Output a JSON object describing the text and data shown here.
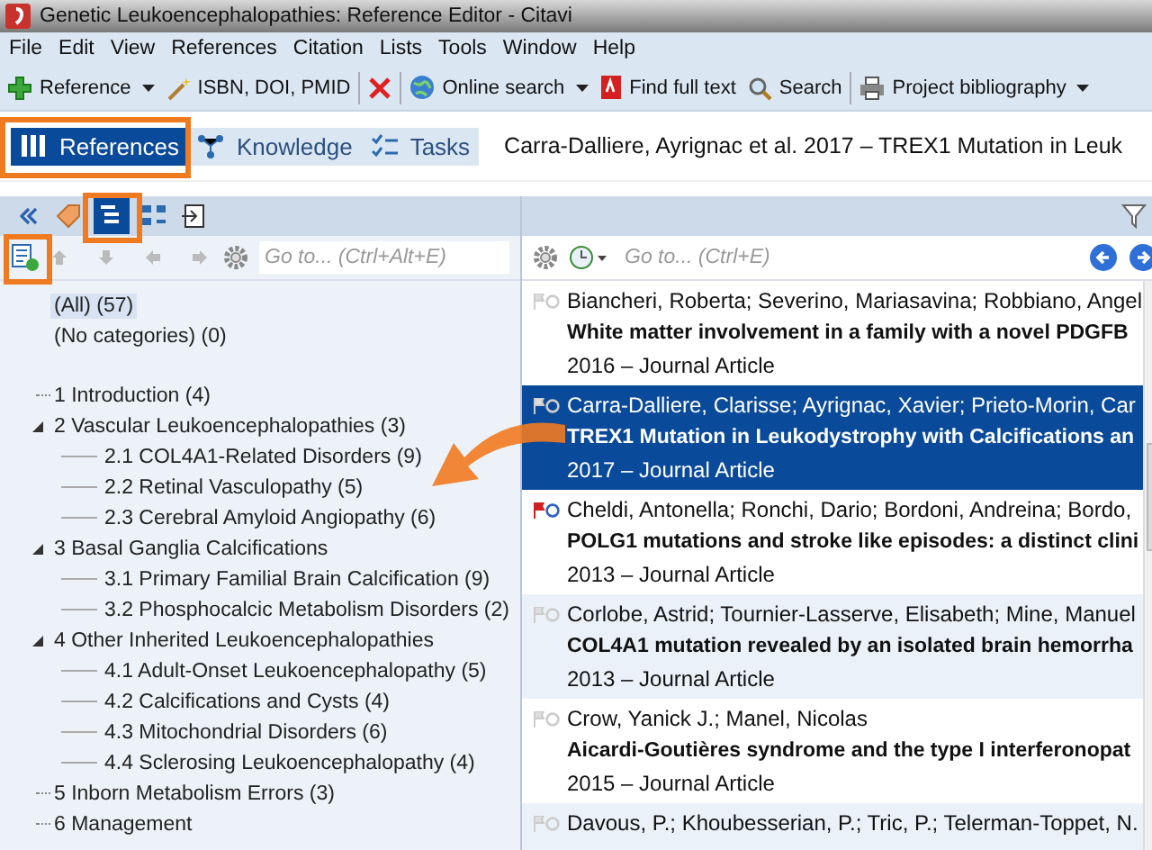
{
  "window": {
    "title": "Genetic Leukoencephalopathies: Reference Editor - Citavi"
  },
  "menu": [
    "File",
    "Edit",
    "View",
    "References",
    "Citation",
    "Lists",
    "Tools",
    "Window",
    "Help"
  ],
  "toolbar": [
    {
      "label": "Reference",
      "dropdown": true
    },
    {
      "label": "ISBN, DOI, PMID",
      "dropdown": false
    },
    {
      "label": "Online search",
      "dropdown": true
    },
    {
      "label": "Find full text",
      "dropdown": false
    },
    {
      "label": "Search",
      "dropdown": false
    },
    {
      "label": "Project bibliography",
      "dropdown": true
    }
  ],
  "tabs": [
    {
      "label": "References",
      "selected": true
    },
    {
      "label": "Knowledge",
      "selected": false
    },
    {
      "label": "Tasks",
      "selected": false
    }
  ],
  "header_title": "Carra-Dalliere, Ayrignac et al. 2017 – TREX1 Mutation in Leuk",
  "category_panel": {
    "goto_placeholder": "Go to... (Ctrl+Alt+E)",
    "special": [
      {
        "label": "(All) (57)",
        "selected": true
      },
      {
        "label": "(No categories) (0)",
        "selected": false
      }
    ],
    "tree": [
      {
        "label": "1 Introduction (4)"
      },
      {
        "label": "2 Vascular Leukoencephalopathies (3)",
        "expanded": true,
        "children": [
          {
            "label": "2.1 COL4A1-Related Disorders (9)"
          },
          {
            "label": "2.2 Retinal Vasculopathy (5)"
          },
          {
            "label": "2.3 Cerebral Amyloid Angiopathy (6)"
          }
        ]
      },
      {
        "label": "3 Basal Ganglia Calcifications",
        "expanded": true,
        "children": [
          {
            "label": "3.1 Primary Familial Brain Calcification (9)"
          },
          {
            "label": "3.2 Phosphocalcic Metabolism Disorders (2)"
          }
        ]
      },
      {
        "label": "4 Other Inherited Leukoencephalopathies",
        "expanded": true,
        "children": [
          {
            "label": "4.1 Adult-Onset Leukoencephalopathy (5)"
          },
          {
            "label": "4.2 Calcifications and Cysts (4)"
          },
          {
            "label": "4.3 Mitochondrial Disorders (6)"
          },
          {
            "label": "4.4 Sclerosing Leukoencephalopathy (4)"
          }
        ]
      },
      {
        "label": "5 Inborn Metabolism Errors (3)"
      },
      {
        "label": "6 Management"
      }
    ]
  },
  "reference_panel": {
    "goto_placeholder": "Go to... (Ctrl+E)",
    "references": [
      {
        "authors": "Biancheri, Roberta; Severino, Mariasavina; Robbiano, Angel",
        "title": "White matter involvement in a family with a novel PDGFB",
        "meta": "2016 – Journal Article",
        "flagged": false,
        "selected": false
      },
      {
        "authors": "Carra-Dalliere, Clarisse; Ayrignac, Xavier; Prieto-Morin, Car",
        "title": "TREX1 Mutation in Leukodystrophy with Calcifications an",
        "meta": "2017 – Journal Article",
        "flagged": false,
        "selected": true
      },
      {
        "authors": "Cheldi, Antonella; Ronchi, Dario; Bordoni, Andreina; Bordo,",
        "title": "POLG1 mutations and stroke like episodes: a distinct clini",
        "meta": "2013 – Journal Article",
        "flagged": true,
        "selected": false
      },
      {
        "authors": "Corlobe, Astrid; Tournier-Lasserve, Elisabeth; Mine, Manuel",
        "title": "COL4A1 mutation revealed by an isolated brain hemorrha",
        "meta": "2013 – Journal Article",
        "flagged": false,
        "selected": false
      },
      {
        "authors": "Crow, Yanick J.; Manel, Nicolas",
        "title": "Aicardi-Goutières syndrome and the type I interferonopat",
        "meta": "2015 – Journal Article",
        "flagged": false,
        "selected": false
      },
      {
        "authors": "Davous, P.; Khoubesserian, P.; Tric, P.; Telerman-Toppet, N.",
        "flagged": false,
        "selected": false
      }
    ]
  }
}
